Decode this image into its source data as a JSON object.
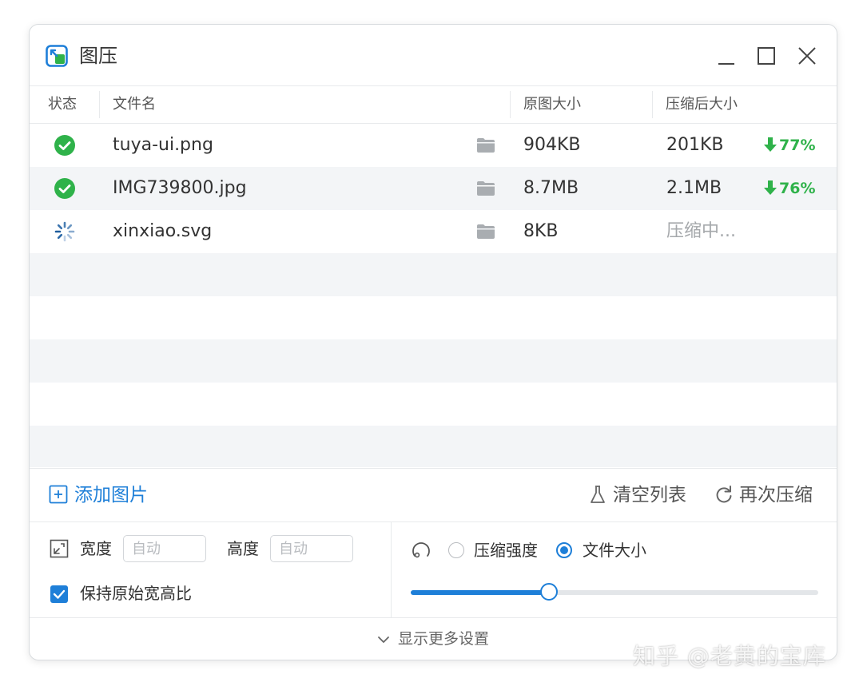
{
  "window": {
    "title": "图压",
    "icon": "app-logo-icon"
  },
  "titlebar_controls": [
    "minimize-icon",
    "maximize-icon",
    "close-icon"
  ],
  "table": {
    "columns": [
      "状态",
      "文件名",
      "原图大小",
      "压缩后大小"
    ],
    "rows": [
      {
        "status": "done",
        "name": "tuya-ui.png",
        "original": "904KB",
        "compressed": "201KB",
        "saving": "77%"
      },
      {
        "status": "done",
        "name": "IMG739800.jpg",
        "original": "8.7MB",
        "compressed": "2.1MB",
        "saving": "76%"
      },
      {
        "status": "processing",
        "name": "xinxiao.svg",
        "original": "8KB",
        "compressed": "压缩中...",
        "saving": ""
      }
    ]
  },
  "actions": {
    "add": "添加图片",
    "clear": "清空列表",
    "recompress": "再次压缩"
  },
  "settings": {
    "width_label": "宽度",
    "width_placeholder": "自动",
    "height_label": "高度",
    "height_placeholder": "自动",
    "keep_ratio_label": "保持原始宽高比",
    "keep_ratio_checked": true,
    "mode_options": [
      "压缩强度",
      "文件大小"
    ],
    "mode_selected": "文件大小",
    "slider_value": 0.34
  },
  "more_settings": "显示更多设置",
  "watermark": "知乎 @老黄的宝库",
  "colors": {
    "accent": "#1e7fd8",
    "success": "#2fb24a",
    "row_alt": "#f3f5f7"
  }
}
